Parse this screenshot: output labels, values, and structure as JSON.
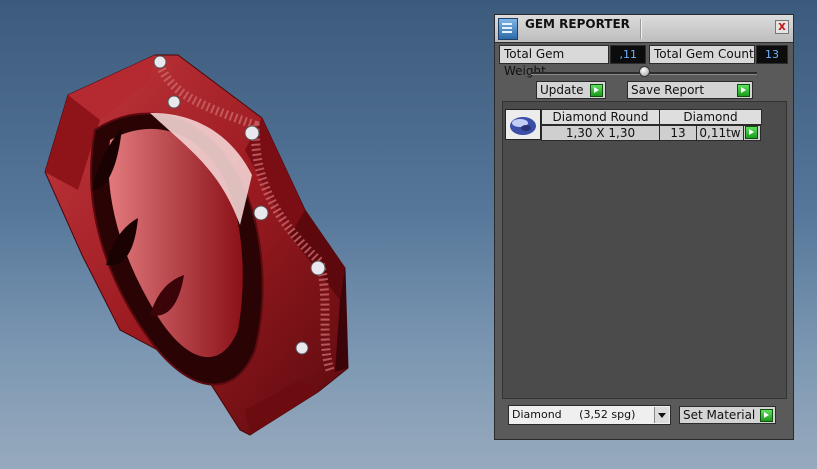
{
  "panel": {
    "title": "GEM REPORTER",
    "close_glyph": "x",
    "total_weight_label": "Total Gem Weight",
    "total_weight_value": ",11",
    "total_count_label": "Total Gem Count",
    "total_count_value": "13",
    "update_label": "Update",
    "save_report_label": "Save Report",
    "gem_rows": [
      {
        "thumb_icon": "diamond-round-icon",
        "shape": "Diamond Round",
        "material": "Diamond",
        "size": "1,30 X 1,30",
        "count": "13",
        "weight": "0,11tw"
      }
    ],
    "material_select": "Diamond     (3,52 spg)",
    "set_material_label": "Set Material"
  },
  "colors": {
    "ring": "#a01c22",
    "background_top": "#3c5a7c",
    "background_bottom": "#97aabd",
    "value_text": "#6fb3ff",
    "go_button": "#2fbf2f"
  }
}
